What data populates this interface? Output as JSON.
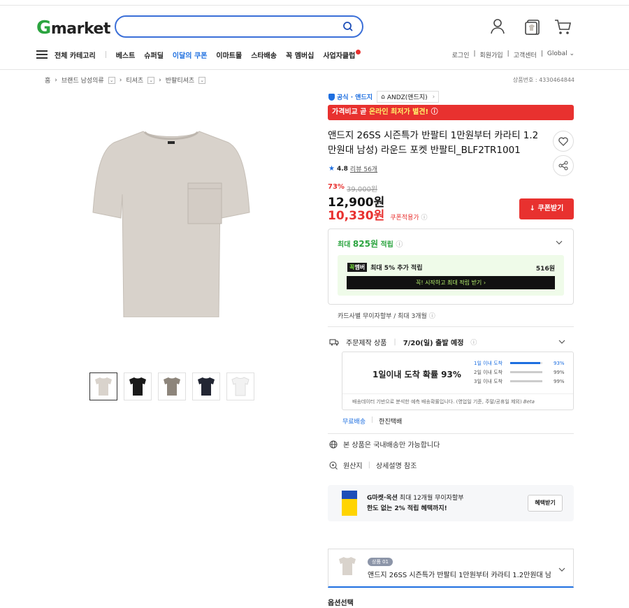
{
  "header": {
    "logo_g": "G",
    "logo_rest": "market",
    "search_placeholder": "",
    "nav": {
      "all_category": "전체 카테고리",
      "items": [
        "베스트",
        "슈퍼딜",
        "이달의 쿠폰",
        "이마트몰",
        "스타배송",
        "꼭 멤버십",
        "사업자클럽"
      ]
    },
    "util": [
      "로그인",
      "회원가입",
      "고객센터",
      "Global"
    ]
  },
  "breadcrumb": {
    "items": [
      "홈",
      "브랜드 남성의류",
      "티셔츠",
      "반팔티셔츠"
    ],
    "product_no": "상품번호 : 4330464844"
  },
  "product": {
    "official_label": "공식 · 앤드지",
    "brand": "ANDZ(앤드지)",
    "banner_white": "가격비교 곧 ",
    "banner_yellow": "온라인 최저가 별견!",
    "title": "앤드지 26SS 시즌특가 반팔티 1만원부터 카라티 1.2만원대 남성) 라운드 포켓 반팔티_BLF2TR1001",
    "rating": "4.8",
    "reviews": "리뷰 56개",
    "discount": "73%",
    "original_price": "39,000원",
    "price": "12,900원",
    "coupon_price": "10,330원",
    "coupon_price_label": "쿠폰적용가",
    "coupon_button": "쿠폰받기",
    "colors": [
      "#d9d3cc",
      "#1a1a1a",
      "#8d857b",
      "#222633",
      "#f2f2f2"
    ]
  },
  "reward": {
    "prefix": "최대 ",
    "amount": "825원",
    "suffix": " 적립",
    "member_tag_a": "꼭",
    "member_tag_b": "멤버",
    "member_text": "최대 5% 추가 적립",
    "member_amount": "516원",
    "member_button": "꼭! 시작하고 최대 적립 받기 ›",
    "card_text": "카드사별 무이자할부 / 최대 3개월"
  },
  "shipping": {
    "type": "주문제작 상품",
    "date": "7/20(일) 출발 예정",
    "probability": "1일이내 도착 확률 93%",
    "rows": [
      {
        "label": "1일 이내 도착",
        "pct": "93%",
        "value": 0.93
      },
      {
        "label": "2일 이내 도착",
        "pct": "99%",
        "value": 0.99
      },
      {
        "label": "3일 이내 도착",
        "pct": "99%",
        "value": 0.99
      }
    ],
    "note": "배송데이터 기반으로 분석한 예측 배송확률입니다. (영업일 기준, 주말/공휴일 제외) ",
    "beta": "Beta",
    "free": "무료배송",
    "carrier": "한진택배",
    "domestic": "본 상품은 국내배송만 가능합니다",
    "origin_label": "원산지",
    "origin_value": "상세설명 참조"
  },
  "promo": {
    "line1_bold": "G마켓·옥션",
    "line1": " 최대 12개월 무이자할부",
    "line2": "한도 없는 2% 적립 혜택까지!",
    "button": "혜택받기"
  },
  "option": {
    "tag": "상품 01",
    "name": "앤드지 26SS 시즌특가 반팔티 1만원부터 카라티 1.2만원대 남...",
    "heading": "옵션선택"
  }
}
